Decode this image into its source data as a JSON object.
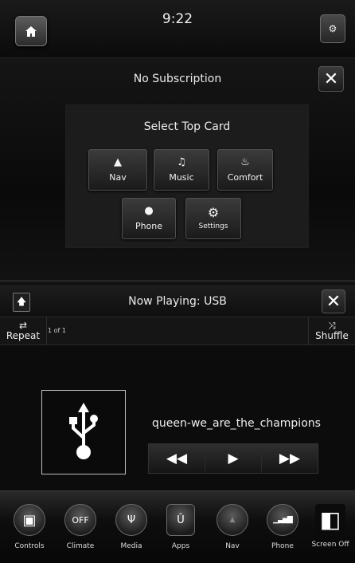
{
  "status": {
    "time": "9:22",
    "home_icon": "home-icon",
    "settings_icon": "gear-icon"
  },
  "top_card": {
    "title": "No Subscription",
    "close_label": "✕",
    "select_title": "Select Top Card",
    "cards": [
      {
        "label": "Nav",
        "icon": "navigation-arrow-icon",
        "glyph": "▲"
      },
      {
        "label": "Music",
        "icon": "music-note-icon",
        "glyph": "♫"
      },
      {
        "label": "Comfort",
        "icon": "comfort-seat-icon",
        "glyph": "♨"
      },
      {
        "label": "Phone",
        "icon": "person-icon",
        "glyph": "●"
      },
      {
        "label": "Settings",
        "icon": "gear-icon",
        "glyph": "⚙"
      }
    ]
  },
  "now_playing": {
    "title": "Now Playing: USB",
    "close_label": "✕",
    "repeat_label": "Repeat",
    "shuffle_label": "Shuffle",
    "track_count": "1 of 1",
    "song": "queen-we_are_the_champions",
    "album_icon": "usb-icon",
    "controls": {
      "rewind": "◀◀",
      "play": "▶",
      "forward": "▶▶"
    }
  },
  "dock": [
    {
      "label": "Controls",
      "icon": "controls-icon",
      "glyph": "▣"
    },
    {
      "label": "Climate",
      "icon": "climate-off-icon",
      "glyph": "OFF"
    },
    {
      "label": "Media",
      "icon": "usb-icon",
      "glyph": "Ψ"
    },
    {
      "label": "Apps",
      "icon": "apps-icon",
      "glyph": "Û"
    },
    {
      "label": "Nav",
      "icon": "navigation-icon",
      "glyph": "▲"
    },
    {
      "label": "Phone",
      "icon": "phone-signal-icon",
      "glyph": "▁▃▅▇"
    },
    {
      "label": "Screen Off",
      "icon": "screen-off-icon",
      "glyph": "◧"
    }
  ]
}
